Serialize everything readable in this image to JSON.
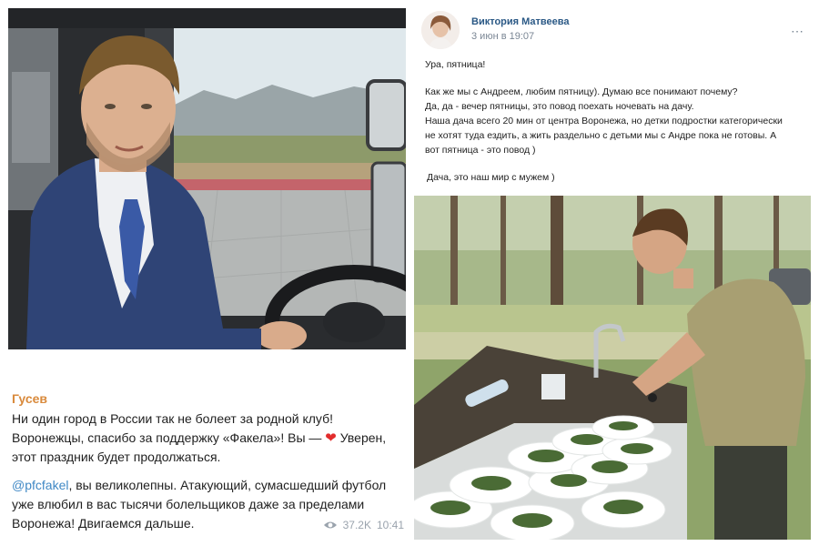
{
  "telegram_post": {
    "author": "Гусев",
    "paragraph1_lines": [
      "Ни один город в России так не болеет за родной клуб!",
      "Воронежцы, спасибо за поддержку «Факела»! Вы —",
      "Уверен,",
      "этот праздник будет продолжаться."
    ],
    "paragraph2_link": "@pfcfakel",
    "paragraph2_lines": [
      ", вы великолепны. Атакующий, сумасшедший футбол",
      "уже влюбил в вас тысячи болельщиков даже за пределами",
      "Воронежа! Двигаемся дальше."
    ],
    "views": "37.2K",
    "time": "10:41",
    "icons": {
      "heart": "heart-emoji",
      "views": "eye-icon"
    },
    "colors": {
      "author": "#d98a3c",
      "link": "#3f88c5",
      "heart": "#e22c2c"
    }
  },
  "vk_post": {
    "author_name": "Виктория Матвеева",
    "date": "3 июн в 19:07",
    "more_icon": "⋯",
    "lines": [
      "Ура, пятница!",
      "Как же мы с Андреем, любим пятницу).  Думаю все понимают почему?",
      "Да, да  - вечер пятницы,  это повод поехать ночевать на дачу.",
      "Наша дача всего 20 мин от центра Воронежа,  но детки подростки категорически",
      "не хотят туда ездить, а жить раздельно с детьми мы с Андре пока не готовы.  А",
      "вот пятница  - это повод )",
      "Дача,  это наш мир с мужем )"
    ],
    "colors": {
      "name": "#2a5885",
      "date": "#7a8694"
    }
  }
}
